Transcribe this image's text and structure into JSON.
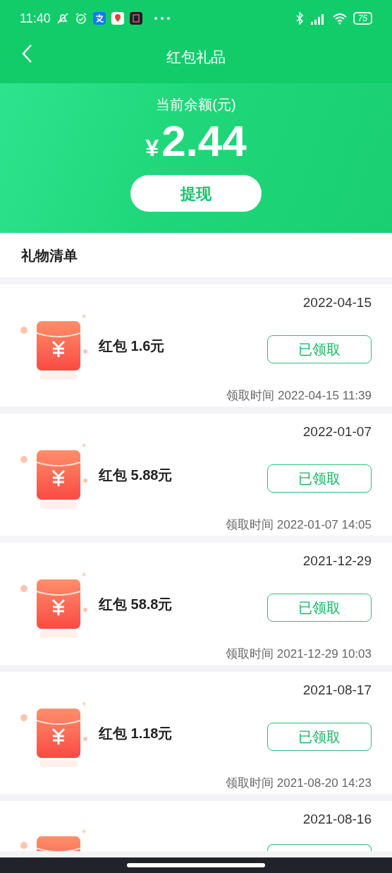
{
  "status_bar": {
    "time": "11:40",
    "battery": "75"
  },
  "header": {
    "title": "红包礼品"
  },
  "balance": {
    "label": "当前余额(元)",
    "currency": "¥",
    "amount": "2.44",
    "button": "提现"
  },
  "section_title": "礼物清单",
  "gifts": [
    {
      "kind": "full",
      "date": "2022-04-15",
      "title": "红包 1.6元",
      "button": "已领取",
      "claim_time": "领取时间 2022-04-15 11:39"
    },
    {
      "kind": "full",
      "date": "2022-01-07",
      "title": "红包 5.88元",
      "button": "已领取",
      "claim_time": "领取时间 2022-01-07 14:05"
    },
    {
      "kind": "full",
      "date": "2021-12-29",
      "title": "红包 58.8元",
      "button": "已领取",
      "claim_time": "领取时间 2021-12-29 10:03"
    },
    {
      "kind": "full",
      "date": "2021-08-17",
      "title": "红包 1.18元",
      "button": "已领取",
      "claim_time": "领取时间 2021-08-20 14:23"
    },
    {
      "kind": "cut",
      "date": "2021-08-16"
    }
  ]
}
